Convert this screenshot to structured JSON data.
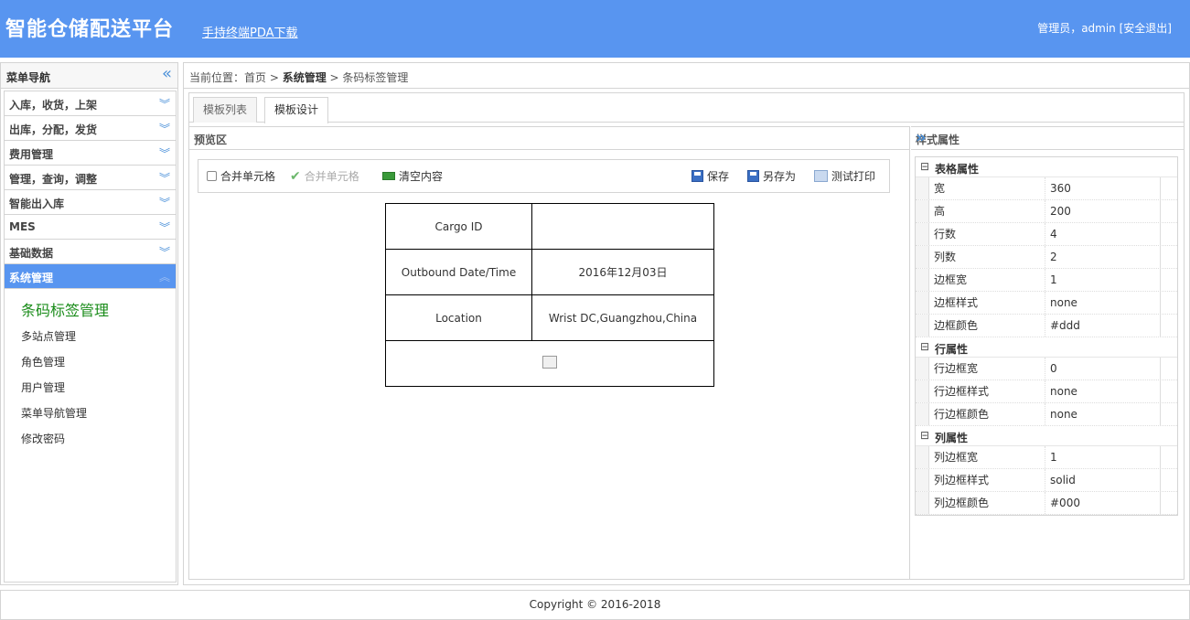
{
  "header": {
    "title": "智能仓储配送平台",
    "pda_link": "手持终端PDA下载",
    "user_text": "管理员，admin",
    "logout": "[安全退出]"
  },
  "sidebar": {
    "title": "菜单导航",
    "menu": [
      {
        "label": "入库，收货，上架"
      },
      {
        "label": "出库，分配，发货"
      },
      {
        "label": "费用管理"
      },
      {
        "label": "管理，查询，调整"
      },
      {
        "label": "智能出入库"
      },
      {
        "label": "MES"
      },
      {
        "label": "基础数据"
      },
      {
        "label": "系统管理"
      }
    ],
    "submenu": [
      {
        "label": "条码标签管理"
      },
      {
        "label": "多站点管理"
      },
      {
        "label": "角色管理"
      },
      {
        "label": "用户管理"
      },
      {
        "label": "菜单导航管理"
      },
      {
        "label": "修改密码"
      }
    ]
  },
  "breadcrumb": {
    "prefix": "当前位置：",
    "home": "首页",
    "sep1": " > ",
    "section": "系统管理",
    "sep2": " > ",
    "page": "条码标签管理"
  },
  "tabs": [
    {
      "label": "模板列表"
    },
    {
      "label": "模板设计"
    }
  ],
  "preview": {
    "title": "预览区",
    "toolbar": {
      "merge_checkbox": "合并单元格",
      "merge_button": "合并单元格",
      "clear": "清空内容",
      "save": "保存",
      "save_as": "另存为",
      "test_print": "测试打印"
    },
    "table": [
      [
        "Cargo ID",
        ""
      ],
      [
        "Outbound Date/Time",
        "2016年12月03日"
      ],
      [
        "Location",
        "Wrist DC,Guangzhou,China"
      ]
    ]
  },
  "properties": {
    "title": "样式属性",
    "groups": [
      {
        "name": "表格属性",
        "rows": [
          {
            "k": "宽",
            "v": "360"
          },
          {
            "k": "高",
            "v": "200"
          },
          {
            "k": "行数",
            "v": "4"
          },
          {
            "k": "列数",
            "v": "2"
          },
          {
            "k": "边框宽",
            "v": "1"
          },
          {
            "k": "边框样式",
            "v": "none"
          },
          {
            "k": "边框颜色",
            "v": "#ddd"
          }
        ]
      },
      {
        "name": "行属性",
        "rows": [
          {
            "k": "行边框宽",
            "v": "0"
          },
          {
            "k": "行边框样式",
            "v": "none"
          },
          {
            "k": "行边框颜色",
            "v": "none"
          }
        ]
      },
      {
        "name": "列属性",
        "rows": [
          {
            "k": "列边框宽",
            "v": "1"
          },
          {
            "k": "列边框样式",
            "v": "solid"
          },
          {
            "k": "列边框颜色",
            "v": "#000"
          }
        ]
      }
    ]
  },
  "footer": {
    "copyright": "Copyright © 2016-2018"
  },
  "colors": {
    "header_bg": "#5895f0",
    "active_menu": "#5895f0",
    "current_submenu": "#1a8c1a"
  }
}
